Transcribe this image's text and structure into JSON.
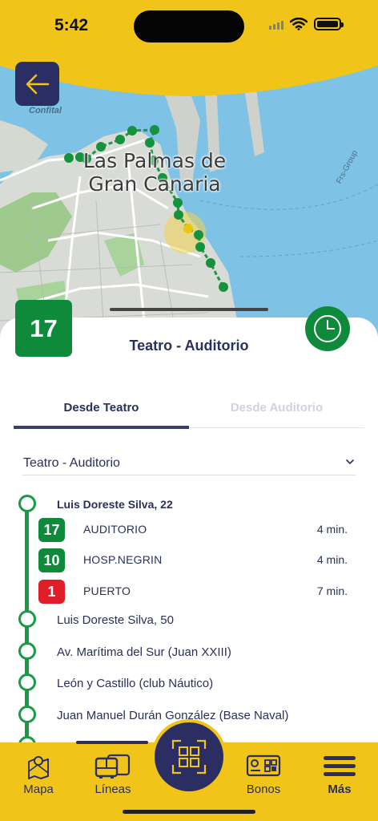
{
  "status_bar": {
    "time": "5:42"
  },
  "map": {
    "city_label": "Las Palmas de Gran Canaria",
    "confital_label": "Confital",
    "frs_label": "Frs-Group"
  },
  "route": {
    "line_number": "17",
    "line_color": "#0f8a3b",
    "title": "Teatro - Auditorio"
  },
  "tabs": [
    {
      "label": "Desde Teatro",
      "active": true
    },
    {
      "label": "Desde Auditorio",
      "active": false
    }
  ],
  "direction_select": {
    "value": "Teatro - Auditorio"
  },
  "stops": [
    {
      "name": "Luis Doreste Silva, 22",
      "arrivals": [
        {
          "line": "17",
          "destination": "AUDITORIO",
          "time": "4 min.",
          "color": "#0f8a3b"
        },
        {
          "line": "10",
          "destination": "HOSP.NEGRIN",
          "time": "4 min.",
          "color": "#0f8a3b"
        },
        {
          "line": "1",
          "destination": "PUERTO",
          "time": "7 min.",
          "color": "#e01e2a"
        }
      ]
    },
    {
      "name": "Luis Doreste Silva, 50"
    },
    {
      "name": "Av. Marítima del Sur (Juan XXIII)"
    },
    {
      "name": "León y Castillo (club Náutico)"
    },
    {
      "name": "Juan Manuel Durán González (Base Naval)"
    }
  ],
  "nav": {
    "items": [
      {
        "label": "Mapa",
        "icon": "map-icon"
      },
      {
        "label": "Líneas",
        "icon": "bus-icon"
      },
      {
        "label": "",
        "icon": "qr-scan-icon"
      },
      {
        "label": "Bonos",
        "icon": "ticket-card-icon"
      },
      {
        "label": "Más",
        "icon": "menu-icon"
      }
    ]
  },
  "colors": {
    "brand_yellow": "#f0c418",
    "brand_navy": "#2a2e63",
    "line_green": "#0f8a3b",
    "line_red": "#e01e2a"
  }
}
